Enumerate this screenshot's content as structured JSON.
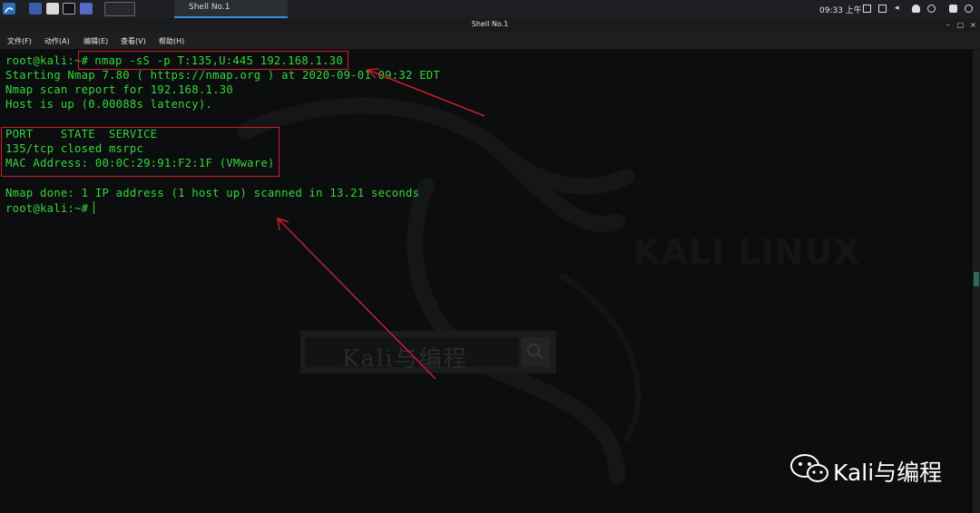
{
  "window": {
    "title": "Shell No.1"
  },
  "taskbar": {
    "task_label": "Shell No.1",
    "clock": "09:33 上午"
  },
  "menu": [
    "文件(F)",
    "动作(A)",
    "编辑(E)",
    "查看(V)",
    "帮助(H)"
  ],
  "terminal": {
    "prompt": "root@kali:~#",
    "command": "nmap -sS -p T:135,U:445 192.168.1.30",
    "lines": [
      "Starting Nmap 7.80 ( https://nmap.org ) at 2020-09-01 09:32 EDT",
      "Nmap scan report for 192.168.1.30",
      "Host is up (0.00088s latency).",
      "",
      "PORT    STATE  SERVICE",
      "135/tcp closed msrpc",
      "MAC Address: 00:0C:29:91:F2:1F (VMware)",
      "",
      "Nmap done: 1 IP address (1 host up) scanned in 13.21 seconds"
    ],
    "final_prompt": "root@kali:~#"
  },
  "watermark": {
    "logo_text": "KALI LINUX",
    "search_text": "Kali与编程"
  },
  "brand": {
    "text": "Kali与编程"
  },
  "colors": {
    "terminal_text": "#35d63c",
    "highlight_box": "#d0202a",
    "accent_tab": "#3b8fd9"
  }
}
